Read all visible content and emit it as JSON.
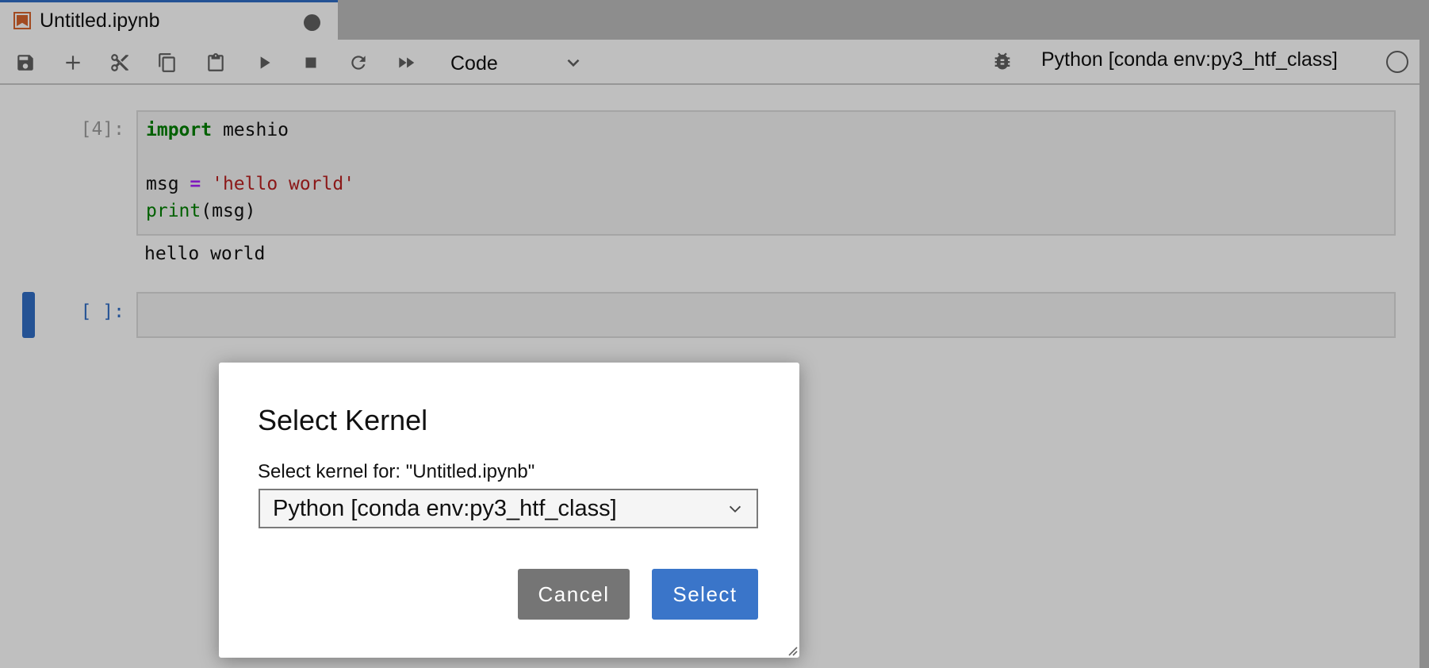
{
  "tab": {
    "title": "Untitled.ipynb",
    "icon": "notebook-icon",
    "unsaved_indicator": "dot-icon"
  },
  "toolbar": {
    "buttons": [
      {
        "name": "save",
        "icon": "save-icon"
      },
      {
        "name": "insert-cell",
        "icon": "plus-icon"
      },
      {
        "name": "cut",
        "icon": "scissors-icon"
      },
      {
        "name": "copy",
        "icon": "copy-icon"
      },
      {
        "name": "paste",
        "icon": "paste-icon"
      },
      {
        "name": "run",
        "icon": "play-icon"
      },
      {
        "name": "interrupt",
        "icon": "stop-icon"
      },
      {
        "name": "restart",
        "icon": "restart-icon"
      },
      {
        "name": "restart-run-all",
        "icon": "fast-forward-icon"
      }
    ],
    "cell_type": "Code",
    "kernel_name": "Python [conda env:py3_htf_class]",
    "kernel_status": "idle"
  },
  "notebook": {
    "cells": [
      {
        "prompt": "[4]:",
        "code_lines": [
          [
            {
              "t": "import",
              "c": "kw"
            },
            {
              "t": " meshio",
              "c": ""
            }
          ],
          [],
          [
            {
              "t": "msg ",
              "c": ""
            },
            {
              "t": "=",
              "c": "op"
            },
            {
              "t": " ",
              "c": ""
            },
            {
              "t": "'hello world'",
              "c": "str"
            }
          ],
          [
            {
              "t": "print",
              "c": "bi"
            },
            {
              "t": "(msg)",
              "c": ""
            }
          ]
        ],
        "output": "hello world"
      },
      {
        "prompt": "[ ]:",
        "code_lines": [],
        "active": true
      }
    ]
  },
  "dialog": {
    "title": "Select Kernel",
    "label": "Select kernel for: \"Untitled.ipynb\"",
    "selected_kernel": "Python [conda env:py3_htf_class]",
    "cancel_label": "Cancel",
    "select_label": "Select",
    "colors": {
      "cancel": "#757575",
      "select": "#3a75c9"
    }
  }
}
